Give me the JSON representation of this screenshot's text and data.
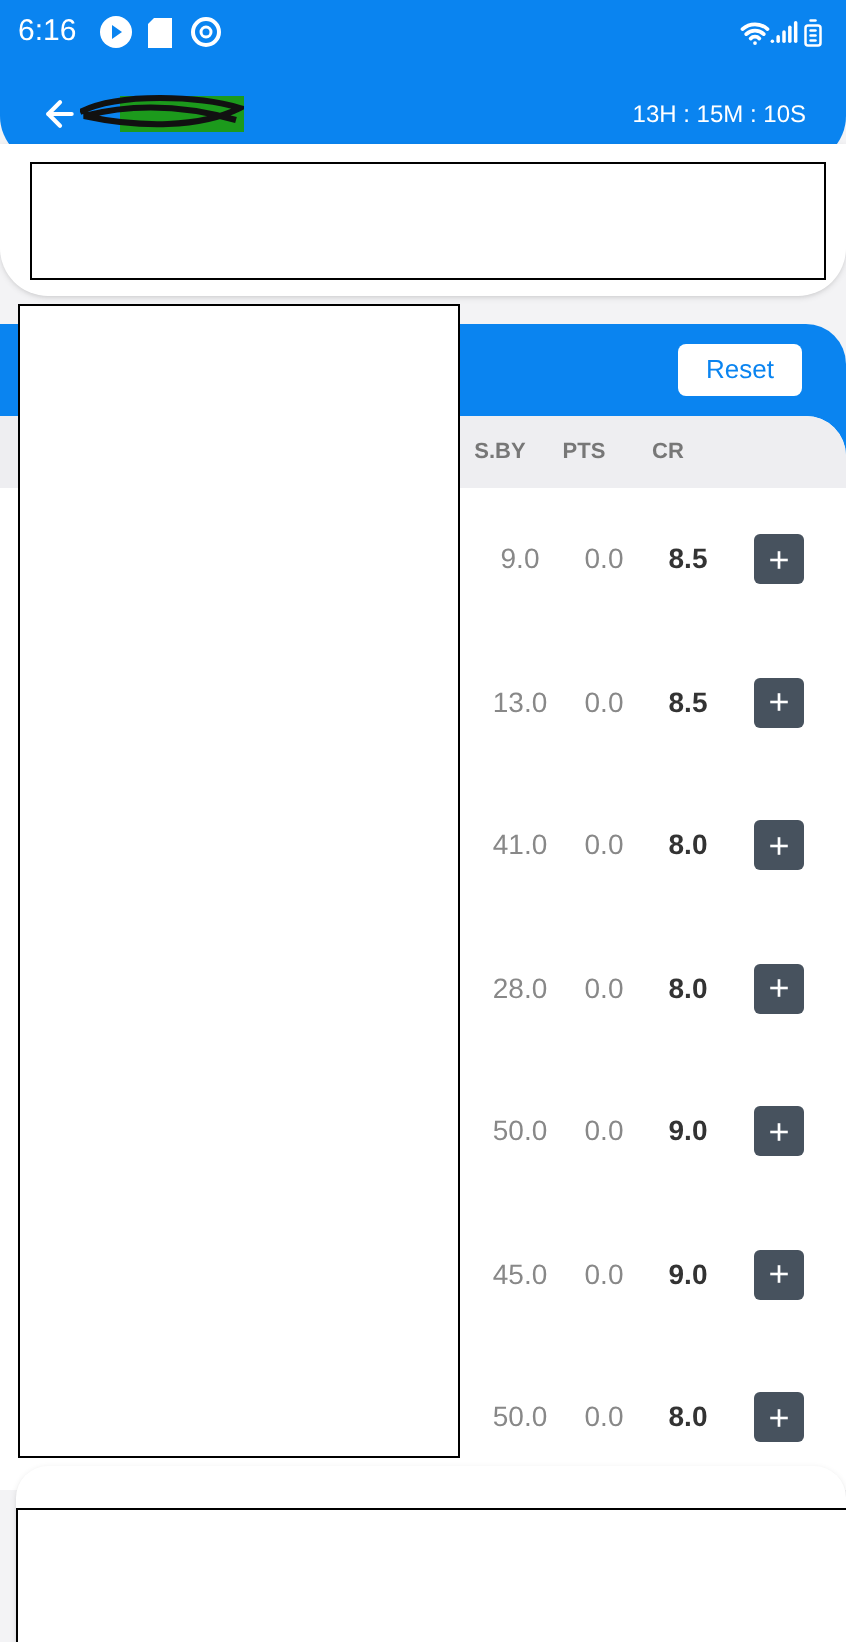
{
  "status_bar": {
    "time": "6:16"
  },
  "header": {
    "countdown": "13H : 15M : 10S"
  },
  "panel": {
    "reset_label": "Reset",
    "columns": [
      "S.BY",
      "PTS",
      "CR"
    ],
    "rows": [
      {
        "sby": "9.0",
        "pts": "0.0",
        "cr": "8.5",
        "action": "+"
      },
      {
        "sby": "13.0",
        "pts": "0.0",
        "cr": "8.5",
        "action": "+"
      },
      {
        "sby": "41.0",
        "pts": "0.0",
        "cr": "8.0",
        "action": "+"
      },
      {
        "sby": "28.0",
        "pts": "0.0",
        "cr": "8.0",
        "action": "+"
      },
      {
        "sby": "50.0",
        "pts": "0.0",
        "cr": "9.0",
        "action": "+"
      },
      {
        "sby": "45.0",
        "pts": "0.0",
        "cr": "9.0",
        "action": "+"
      },
      {
        "sby": "50.0",
        "pts": "0.0",
        "cr": "8.0",
        "action": "+"
      }
    ]
  }
}
